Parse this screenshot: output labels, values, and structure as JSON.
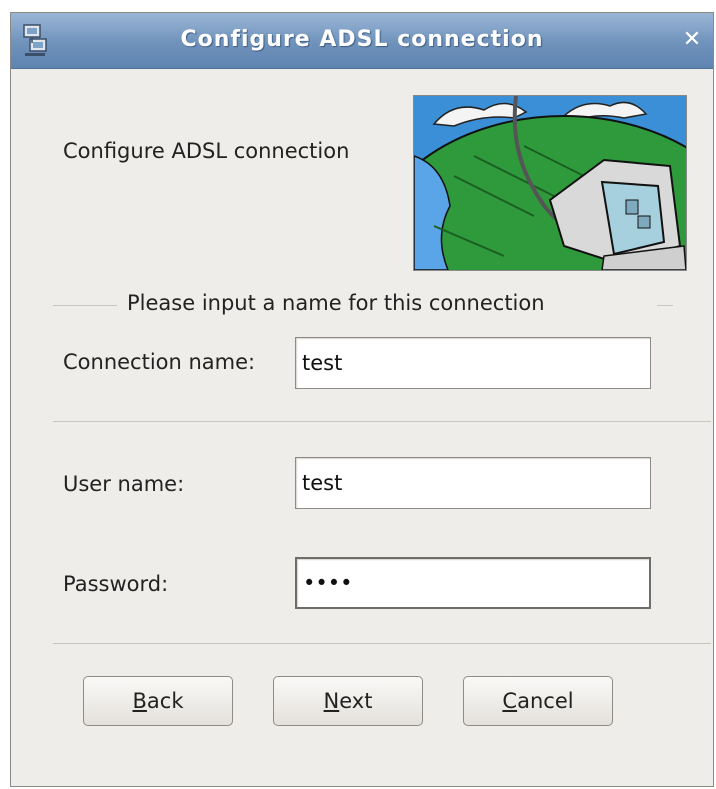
{
  "window": {
    "title": "Configure ADSL connection",
    "close_glyph": "✕",
    "app_icon": "network-computer-icon"
  },
  "header": {
    "label": "Configure ADSL connection",
    "image": "globe-computer-illustration"
  },
  "group": {
    "title": "Please input a name for this connection"
  },
  "fields": {
    "connection_name": {
      "label": "Connection name:",
      "value": "test"
    },
    "user_name": {
      "label": "User name:",
      "value": "test"
    },
    "password": {
      "label": "Password:",
      "value": "••••"
    }
  },
  "buttons": {
    "back": {
      "mnemonic": "B",
      "rest": "ack"
    },
    "next": {
      "mnemonic": "N",
      "rest": "ext"
    },
    "cancel": {
      "mnemonic": "C",
      "rest": "ancel"
    }
  }
}
